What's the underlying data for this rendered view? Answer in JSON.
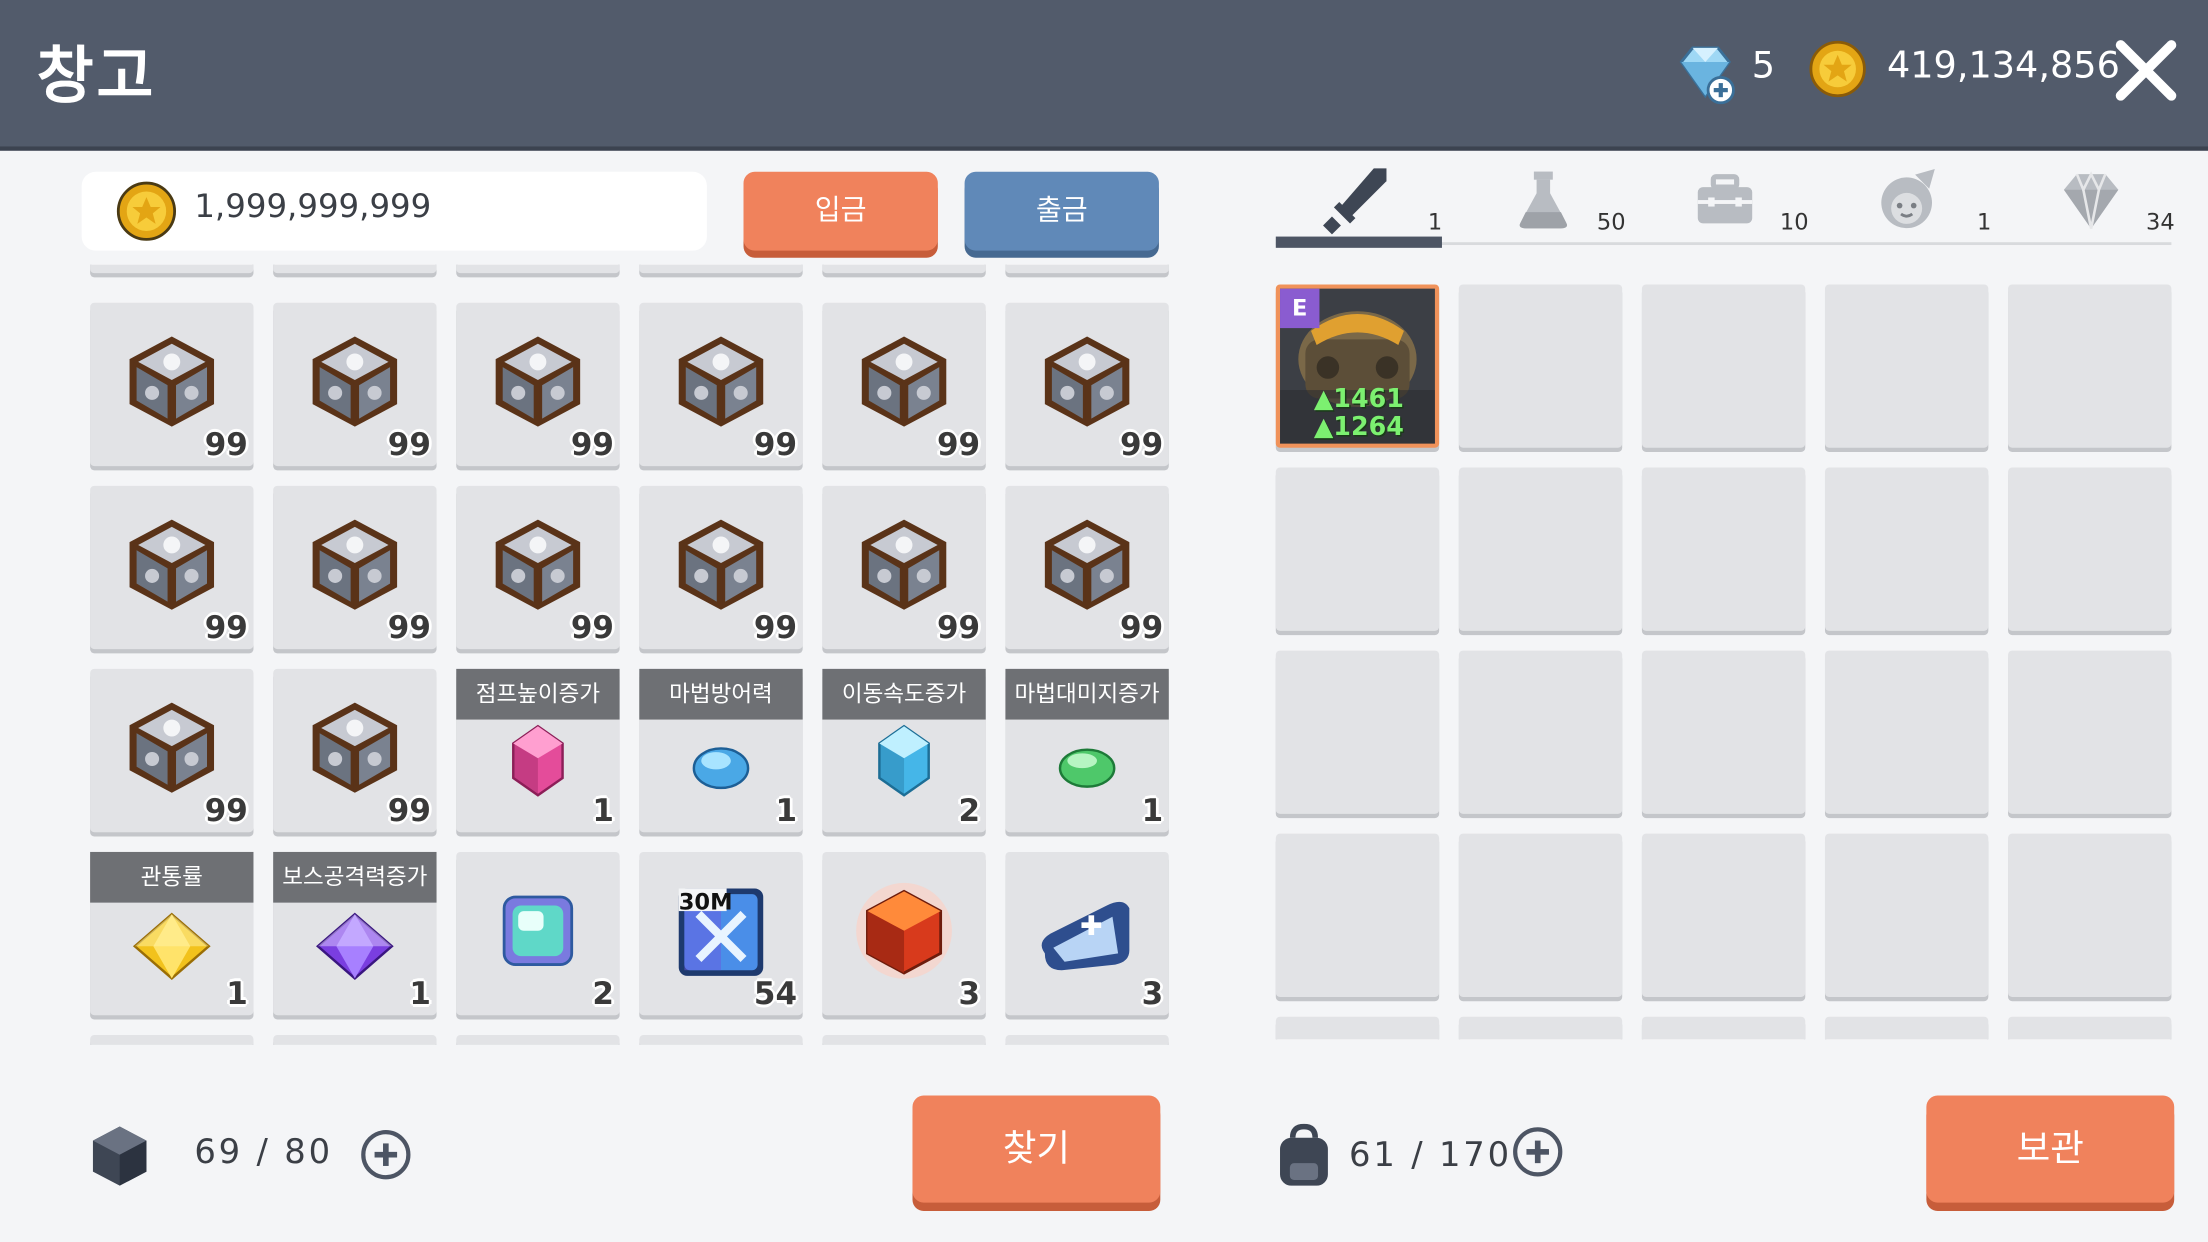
{
  "header": {
    "title": "창고",
    "gem_count": "5",
    "gold": "419,134,856",
    "close_icon": "close-icon",
    "gem_icon": "gem-plus-icon",
    "coin_icon": "gold-coin-icon"
  },
  "storage": {
    "coin_amount": "1,999,999,999",
    "deposit_label": "입금",
    "withdraw_label": "출금",
    "capacity": "69 / 80",
    "find_label": "찾기",
    "items": [
      {
        "icon": "cube-icon",
        "count": "99",
        "label": ""
      },
      {
        "icon": "cube-icon",
        "count": "99",
        "label": ""
      },
      {
        "icon": "cube-icon",
        "count": "99",
        "label": ""
      },
      {
        "icon": "cube-icon",
        "count": "99",
        "label": ""
      },
      {
        "icon": "cube-icon",
        "count": "99",
        "label": ""
      },
      {
        "icon": "cube-icon",
        "count": "99",
        "label": ""
      },
      {
        "icon": "cube-icon",
        "count": "99",
        "label": ""
      },
      {
        "icon": "cube-icon",
        "count": "99",
        "label": ""
      },
      {
        "icon": "cube-icon",
        "count": "99",
        "label": ""
      },
      {
        "icon": "cube-icon",
        "count": "99",
        "label": ""
      },
      {
        "icon": "cube-icon",
        "count": "99",
        "label": ""
      },
      {
        "icon": "cube-icon",
        "count": "99",
        "label": ""
      },
      {
        "icon": "cube-icon",
        "count": "99",
        "label": ""
      },
      {
        "icon": "cube-icon",
        "count": "99",
        "label": ""
      },
      {
        "icon": "pink-gem-icon",
        "count": "1",
        "label": "점프높이증가"
      },
      {
        "icon": "blue-gem-icon",
        "count": "1",
        "label": "마법방어력"
      },
      {
        "icon": "cyan-gem-icon",
        "count": "2",
        "label": "이동속도증가"
      },
      {
        "icon": "green-gem-icon",
        "count": "1",
        "label": "마법대미지증가"
      },
      {
        "icon": "yellow-gem-icon",
        "count": "1",
        "label": "관통률"
      },
      {
        "icon": "purple-gem-icon",
        "count": "1",
        "label": "보스공격력증가"
      },
      {
        "icon": "rainbow-gem-icon",
        "count": "2",
        "label": ""
      },
      {
        "icon": "ticket-30m-icon",
        "count": "54",
        "label": "",
        "badge": "30M"
      },
      {
        "icon": "red-cube-icon",
        "count": "3",
        "label": ""
      },
      {
        "icon": "scroll-icon",
        "count": "3",
        "label": ""
      }
    ]
  },
  "bag": {
    "capacity": "61 / 170",
    "store_label": "보관",
    "tabs": [
      {
        "icon": "sword-icon",
        "count": "1"
      },
      {
        "icon": "potion-icon",
        "count": "50"
      },
      {
        "icon": "chest-icon",
        "count": "10"
      },
      {
        "icon": "pet-icon",
        "count": "1"
      },
      {
        "icon": "diamond-icon",
        "count": "34"
      }
    ],
    "equipped": {
      "badge": "E",
      "stat1": "▲1461",
      "stat2": "▲1264",
      "icon": "armor-icon"
    }
  },
  "colors": {
    "header_bg": "#525b6b",
    "accent_orange": "#f0825c",
    "accent_blue": "#6089b8"
  }
}
